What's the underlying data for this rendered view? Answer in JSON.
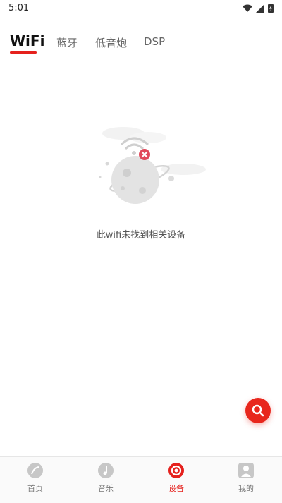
{
  "status_bar": {
    "time": "5:01"
  },
  "tabs": [
    {
      "label": "WiFi",
      "active": true
    },
    {
      "label": "蓝牙"
    },
    {
      "label": "低音炮"
    },
    {
      "label": "DSP"
    }
  ],
  "empty_state": {
    "message": "此wifi未找到相关设备"
  },
  "bottom_nav": [
    {
      "label": "首页",
      "icon": "home-icon"
    },
    {
      "label": "音乐",
      "icon": "music-icon"
    },
    {
      "label": "设备",
      "icon": "device-icon",
      "active": true
    },
    {
      "label": "我的",
      "icon": "profile-icon"
    }
  ],
  "colors": {
    "accent": "#e5211d",
    "inactive_icon": "#c7c7c7"
  }
}
